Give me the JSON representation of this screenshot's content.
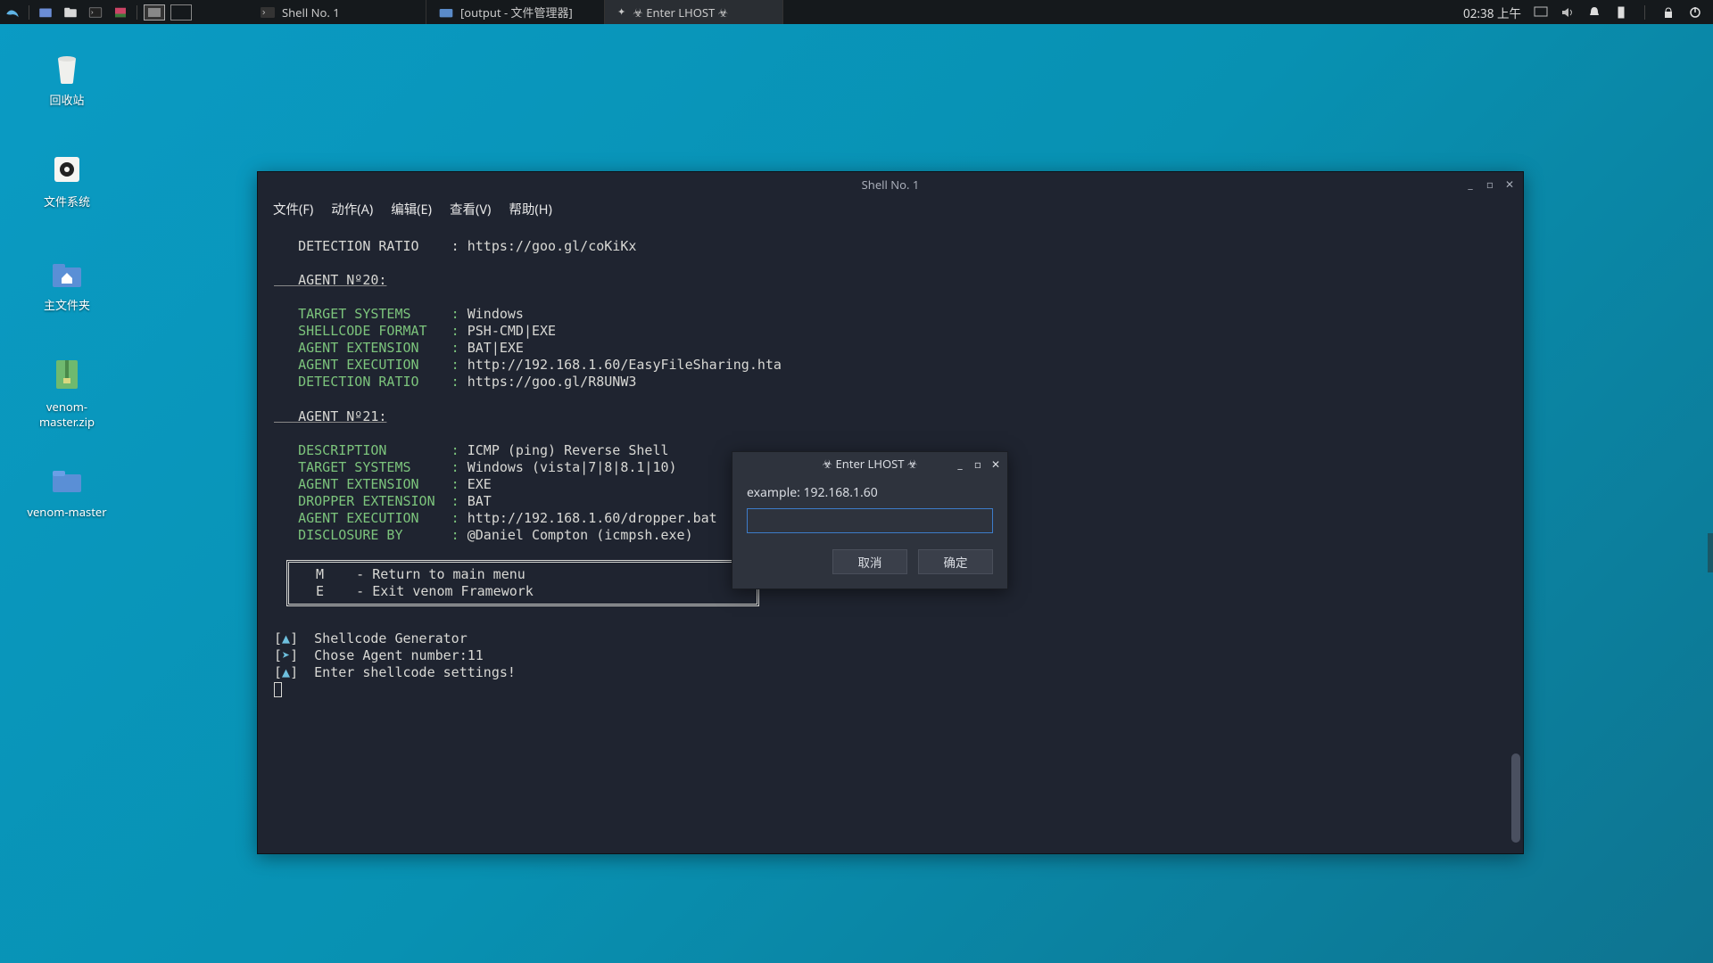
{
  "panel": {
    "taskbar": [
      {
        "label": "Shell No. 1"
      },
      {
        "label": "[output - 文件管理器]"
      },
      {
        "label": "☣ Enter LHOST ☣"
      }
    ],
    "clock": "02:38 上午"
  },
  "desktop": {
    "trash": "回收站",
    "filesystem": "文件系统",
    "home": "主文件夹",
    "zip": "venom-master.zip",
    "folder": "venom-master"
  },
  "terminal": {
    "title": "Shell No. 1",
    "menu": [
      "文件(F)",
      "动作(A)",
      "编辑(E)",
      "查看(V)",
      "帮助(H)"
    ],
    "lines": {
      "det1_label": "   DETECTION RATIO    : ",
      "det1_val": "https://goo.gl/coKiKx",
      "agent20": "   AGENT Nº20:",
      "a20_target_l": "   TARGET SYSTEMS     : ",
      "a20_target_v": "Windows",
      "a20_shell_l": "   SHELLCODE FORMAT   : ",
      "a20_shell_v": "PSH-CMD|EXE",
      "a20_ext_l": "   AGENT EXTENSION    : ",
      "a20_ext_v": "BAT|EXE",
      "a20_exec_l": "   AGENT EXECUTION    : ",
      "a20_exec_v": "http://192.168.1.60/EasyFileSharing.hta",
      "a20_det_l": "   DETECTION RATIO    : ",
      "a20_det_v": "https://goo.gl/R8UNW3",
      "agent21": "   AGENT Nº21:",
      "a21_desc_l": "   DESCRIPTION        : ",
      "a21_desc_v": "ICMP (ping) Reverse Shell",
      "a21_target_l": "   TARGET SYSTEMS     : ",
      "a21_target_v": "Windows (vista|7|8|8.1|10)",
      "a21_ext_l": "   AGENT EXTENSION    : ",
      "a21_ext_v": "EXE",
      "a21_drop_l": "   DROPPER EXTENSION  : ",
      "a21_drop_v": "BAT",
      "a21_exec_l": "   AGENT EXECUTION    : ",
      "a21_exec_v": "http://192.168.1.60/dropper.bat",
      "a21_disc_l": "   DISCLOSURE BY      : ",
      "a21_disc_v": "@Daniel Compton (icmpsh.exe)",
      "menu_m": "M    - Return to main menu",
      "menu_e": "E    - Exit venom Framework",
      "gen": "Shellcode Generator",
      "chose": "Chose Agent number:11",
      "enter": "Enter shellcode settings!"
    }
  },
  "dialog": {
    "title": "☣ Enter LHOST ☣",
    "label": "example: 192.168.1.60",
    "input_value": "",
    "cancel": "取消",
    "ok": "确定"
  }
}
